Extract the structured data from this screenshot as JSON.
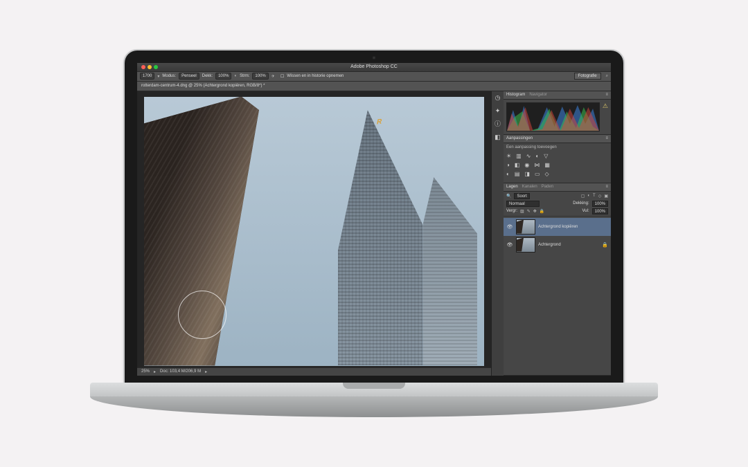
{
  "titlebar": {
    "title": "Adobe Photoshop CC"
  },
  "options": {
    "brush_size": "1700",
    "mode_label": "Modus:",
    "mode_value": "Penseel",
    "opacity_label": "Dekk:",
    "opacity_value": "100%",
    "flow_label": "Strm:",
    "flow_value": "100%",
    "erase_history": "Wissen en in historie opnemen",
    "workspace": "Fotografie"
  },
  "document": {
    "tab": "rotterdam-centrum-4.dng @ 25% (Achtergrond kopiëren, RGB/8*) *",
    "logo_letter": "R"
  },
  "status": {
    "zoom": "25%",
    "info": "Doc: 103,4 M/206,9 M"
  },
  "panels": {
    "histogram_tab": "Histogram",
    "navigator_tab": "Navigator",
    "adjustments_tab": "Aanpassingen",
    "adjustments_hint": "Een aanpassing toevoegen",
    "layers_tab": "Lagen",
    "channels_tab": "Kanalen",
    "paths_tab": "Paden"
  },
  "layers": {
    "filter_label": "Soort",
    "blend_mode": "Normaal",
    "opacity_label": "Dekking:",
    "opacity_value": "100%",
    "lock_label": "Vergr:",
    "fill_label": "Vul:",
    "fill_value": "100%",
    "items": [
      {
        "name": "Achtergrond kopiëren",
        "selected": true,
        "locked": false
      },
      {
        "name": "Achtergrond",
        "selected": false,
        "locked": true
      }
    ]
  }
}
